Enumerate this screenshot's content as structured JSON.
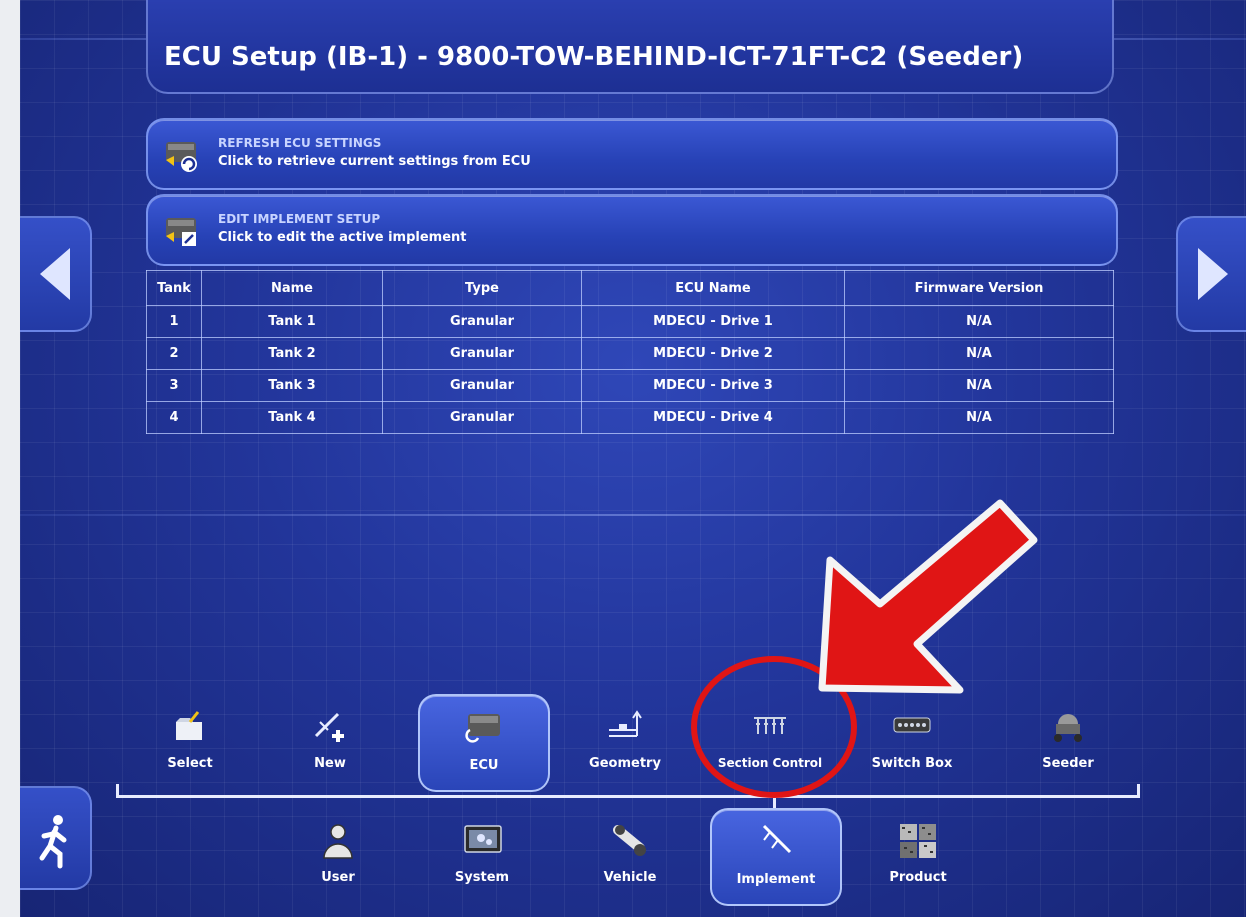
{
  "header": {
    "title": "ECU Setup (IB-1) - 9800-TOW-BEHIND-ICT-71FT-C2 (Seeder)"
  },
  "actions": [
    {
      "heading": "REFRESH ECU SETTINGS",
      "description": "Click to retrieve current settings from ECU",
      "icon": "refresh-ecu-icon"
    },
    {
      "heading": "EDIT IMPLEMENT SETUP",
      "description": "Click to edit the active implement",
      "icon": "edit-implement-icon"
    }
  ],
  "table": {
    "columns": [
      "Tank",
      "Name",
      "Type",
      "ECU Name",
      "Firmware Version"
    ],
    "rows": [
      [
        "1",
        "Tank 1",
        "Granular",
        "MDECU - Drive 1",
        "N/A"
      ],
      [
        "2",
        "Tank 2",
        "Granular",
        "MDECU - Drive 2",
        "N/A"
      ],
      [
        "3",
        "Tank 3",
        "Granular",
        "MDECU - Drive 3",
        "N/A"
      ],
      [
        "4",
        "Tank 4",
        "Granular",
        "MDECU - Drive 4",
        "N/A"
      ]
    ]
  },
  "implement_toolbar": [
    {
      "label": "Select",
      "icon": "folder-icon",
      "active": false
    },
    {
      "label": "New",
      "icon": "new-implement-icon",
      "active": false
    },
    {
      "label": "ECU",
      "icon": "ecu-icon",
      "active": true
    },
    {
      "label": "Geometry",
      "icon": "geometry-icon",
      "active": false
    },
    {
      "label": "Section Control",
      "icon": "section-control-icon",
      "active": false
    },
    {
      "label": "Switch Box",
      "icon": "switch-box-icon",
      "active": false
    },
    {
      "label": "Seeder",
      "icon": "seeder-icon",
      "active": false
    }
  ],
  "main_toolbar": [
    {
      "label": "User",
      "icon": "user-icon",
      "active": false
    },
    {
      "label": "System",
      "icon": "system-icon",
      "active": false
    },
    {
      "label": "Vehicle",
      "icon": "vehicle-icon",
      "active": false
    },
    {
      "label": "Implement",
      "icon": "implement-icon",
      "active": true
    },
    {
      "label": "Product",
      "icon": "product-icon",
      "active": false
    }
  ],
  "annotation": {
    "color": "#e01515",
    "target": "Section Control"
  }
}
